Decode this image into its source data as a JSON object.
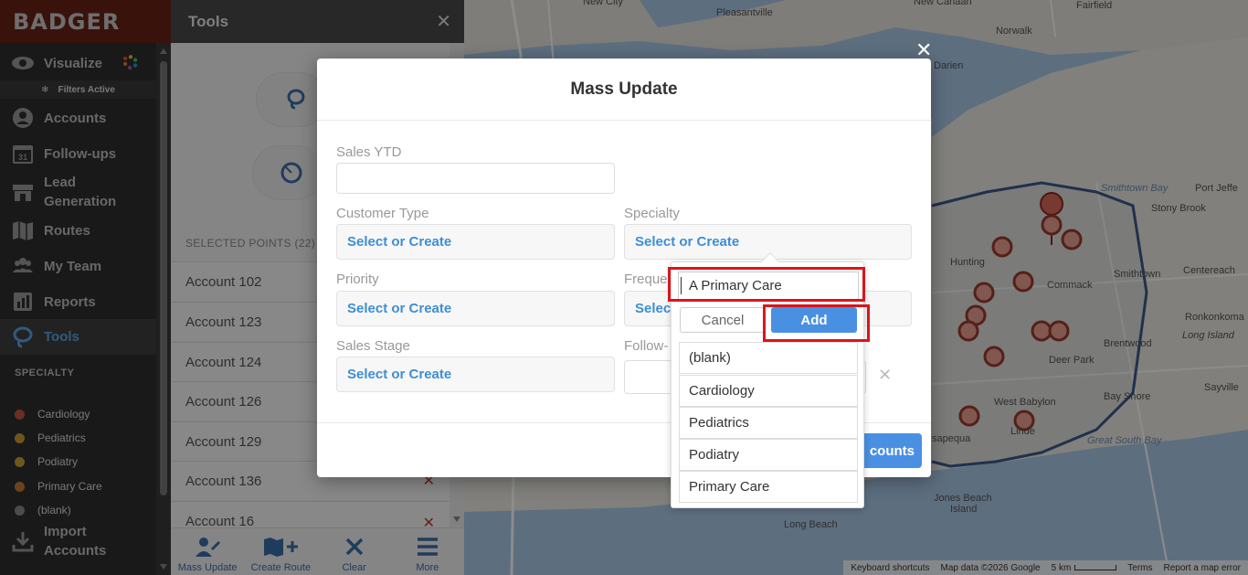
{
  "app": {
    "logo": "BADGER"
  },
  "nav": {
    "filters_active": "Filters Active",
    "items": [
      {
        "label": "Visualize",
        "icon": "eye-icon"
      },
      {
        "label": "Accounts",
        "icon": "user-circle-icon"
      },
      {
        "label": "Follow-ups",
        "icon": "calendar-icon"
      },
      {
        "label": "Lead Generation",
        "icon": "storefront-icon"
      },
      {
        "label": "Routes",
        "icon": "map-icon"
      },
      {
        "label": "My Team",
        "icon": "team-icon"
      },
      {
        "label": "Reports",
        "icon": "reports-icon"
      },
      {
        "label": "Tools",
        "icon": "lasso-icon"
      },
      {
        "label": "Import Accounts",
        "icon": "import-icon"
      }
    ],
    "section_label": "SPECIALTY",
    "legend": [
      {
        "label": "Cardiology",
        "color": "#c0573f"
      },
      {
        "label": "Pediatrics",
        "color": "#c99a34"
      },
      {
        "label": "Podiatry",
        "color": "#c0a23a"
      },
      {
        "label": "Primary Care",
        "color": "#c77a2e"
      },
      {
        "label": "(blank)",
        "color": "#8a8a8a"
      }
    ]
  },
  "tools_panel": {
    "title": "Tools",
    "selected_points": "SELECTED POINTS (22)",
    "accounts": [
      "Account 102",
      "Account 123",
      "Account 124",
      "Account 126",
      "Account 129",
      "Account 136",
      "Account 16"
    ],
    "footer": [
      {
        "label": "Mass Update",
        "icon": "mass-update-icon"
      },
      {
        "label": "Create Route",
        "icon": "create-route-icon"
      },
      {
        "label": "Clear",
        "icon": "clear-icon"
      },
      {
        "label": "More",
        "icon": "more-icon"
      }
    ]
  },
  "map": {
    "labels": {
      "new_city": "New City",
      "pleasantville": "Pleasantville",
      "new_canaan": "New Canaan",
      "fairfield": "Fairfield",
      "norwalk": "Norwalk",
      "darien": "Darien",
      "huntington": "Hunting",
      "commack": "Commack",
      "smithtown": "Smithtown",
      "centereach": "Centereach",
      "stony_brook": "Stony Brook",
      "port_jefferson": "Port Jeffe",
      "ronkonkoma": "Ronkonkoma",
      "long_island": "Long Island",
      "brentwood": "Brentwood",
      "deer_park": "Deer Park",
      "west_babylon": "West Babylon",
      "lindenhurst": "Linde",
      "massapequa": "sapequa",
      "bay_shore": "Bay Shore",
      "sayville": "Sayville",
      "great_south_bay": "Great South Bay",
      "jones_beach": "Jones Beach",
      "jones_beach_2": "Island",
      "long_beach": "Long Beach",
      "smithtown_bay": "Smithtown Bay"
    },
    "footer": {
      "shortcuts": "Keyboard shortcuts",
      "data": "Map data ©2026 Google",
      "scale": "5 km",
      "terms": "Terms",
      "report": "Report a map error"
    }
  },
  "modal": {
    "title": "Mass Update",
    "fields": {
      "sales_ytd": "Sales YTD",
      "customer_type": "Customer Type",
      "specialty": "Specialty",
      "priority": "Priority",
      "frequency": "Freque",
      "sales_stage": "Sales Stage",
      "follow_up": "Follow-"
    },
    "select_placeholder": "Select or Create",
    "select_partial": "Selec",
    "update_label": "counts"
  },
  "dropdown": {
    "input_value": "A Primary Care",
    "cancel": "Cancel",
    "add": "Add",
    "options": [
      "(blank)",
      "Cardiology",
      "Pediatrics",
      "Podiatry",
      "Primary Care"
    ]
  }
}
